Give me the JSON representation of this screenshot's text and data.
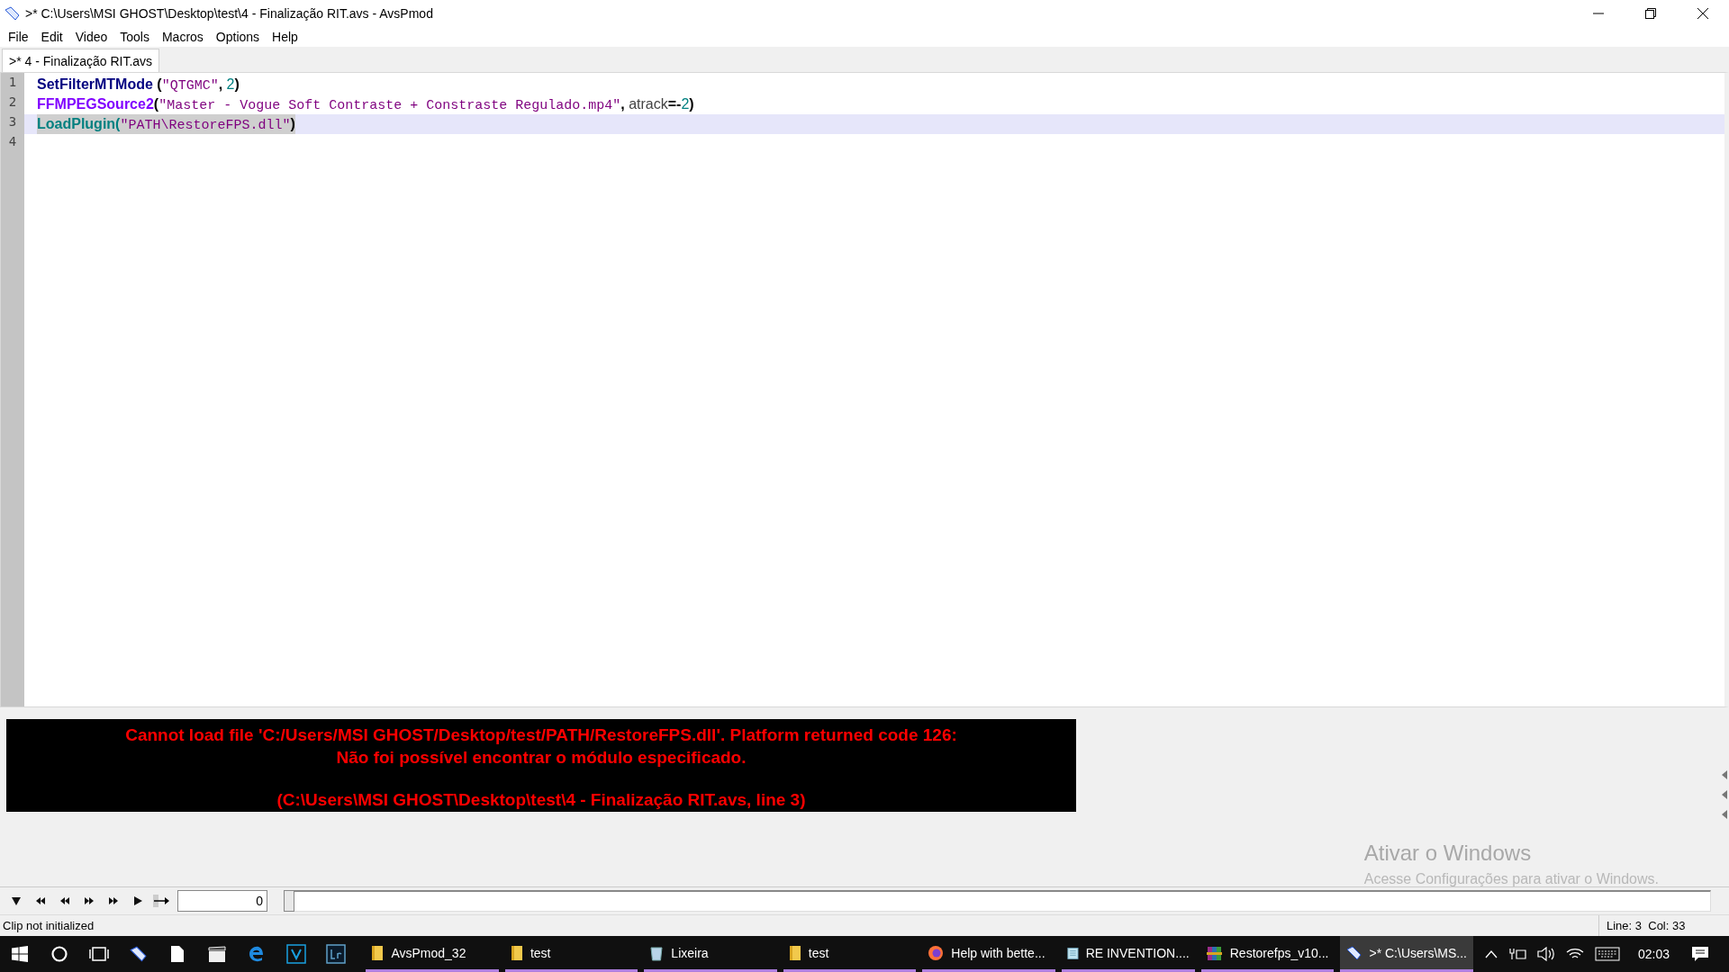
{
  "window": {
    "title": ">* C:\\Users\\MSI GHOST\\Desktop\\test\\4 - Finalização RIT.avs - AvsPmod"
  },
  "menu": [
    "File",
    "Edit",
    "Video",
    "Tools",
    "Macros",
    "Options",
    "Help"
  ],
  "tabs": [
    {
      "label": ">* 4 - Finalização RIT.avs",
      "selected": true
    }
  ],
  "editor": {
    "line_numbers": [
      "1",
      "2",
      "3",
      "4"
    ],
    "lines": [
      {
        "current": false,
        "selected": false,
        "tokens": [
          {
            "text": "SetFilterMTMode",
            "kind": "keyword"
          },
          {
            "text": " (",
            "kind": "operator"
          },
          {
            "text": "\"QTGMC\"",
            "kind": "string"
          },
          {
            "text": ", ",
            "kind": "operator"
          },
          {
            "text": "2",
            "kind": "number"
          },
          {
            "text": ")",
            "kind": "operator"
          }
        ]
      },
      {
        "current": false,
        "selected": false,
        "tokens": [
          {
            "text": "FFMPEGSource2",
            "kind": "plugin"
          },
          {
            "text": "(",
            "kind": "operator"
          },
          {
            "text": "\"Master - Vogue Soft Contraste + Constraste Regulado.mp4\"",
            "kind": "string"
          },
          {
            "text": ", ",
            "kind": "operator"
          },
          {
            "text": "atrack",
            "kind": "plain"
          },
          {
            "text": "=-",
            "kind": "operator"
          },
          {
            "text": "2",
            "kind": "number"
          },
          {
            "text": ")",
            "kind": "operator"
          }
        ]
      },
      {
        "current": true,
        "selected": true,
        "tokens": [
          {
            "text": "LoadPlugin",
            "kind": "internal"
          },
          {
            "text": "(",
            "kind": "internal"
          },
          {
            "text": "\"PATH\\RestoreFPS.dll\"",
            "kind": "string"
          },
          {
            "text": ")",
            "kind": "operator"
          }
        ]
      }
    ]
  },
  "error": {
    "message_lines": [
      "Cannot load file 'C:/Users/MSI GHOST/Desktop/test/PATH/RestoreFPS.dll'. Platform returned code 126:",
      "Não foi possível encontrar o módulo especificado."
    ],
    "location": "(C:\\Users\\MSI GHOST\\Desktop\\test\\4 - Finalização RIT.avs, line 3)"
  },
  "activation_notice": {
    "title": "Ativar o Windows",
    "subtitle": "Acesse Configurações para ativar o Windows."
  },
  "player": {
    "frame": "0",
    "level": 0
  },
  "status_bar": {
    "message": "Clip not initialized",
    "position": "Line: 3  Col: 33"
  },
  "taskbar": {
    "windows": [
      {
        "label": "AvsPmod_32",
        "kind": "folder",
        "selected": false
      },
      {
        "label": "test",
        "kind": "folder",
        "selected": false
      },
      {
        "label": "Lixeira",
        "kind": "recycle",
        "selected": false
      },
      {
        "label": "test",
        "kind": "folder",
        "selected": false
      },
      {
        "label": "Help with bette...",
        "kind": "browser",
        "selected": false
      },
      {
        "label": "RE INVENTION....",
        "kind": "notepad",
        "selected": false
      },
      {
        "label": "Restorefps_v10...",
        "kind": "archive",
        "selected": false
      },
      {
        "label": ">* C:\\Users\\MS...",
        "kind": "avspmod",
        "selected": true
      }
    ],
    "clock": "02:03"
  }
}
